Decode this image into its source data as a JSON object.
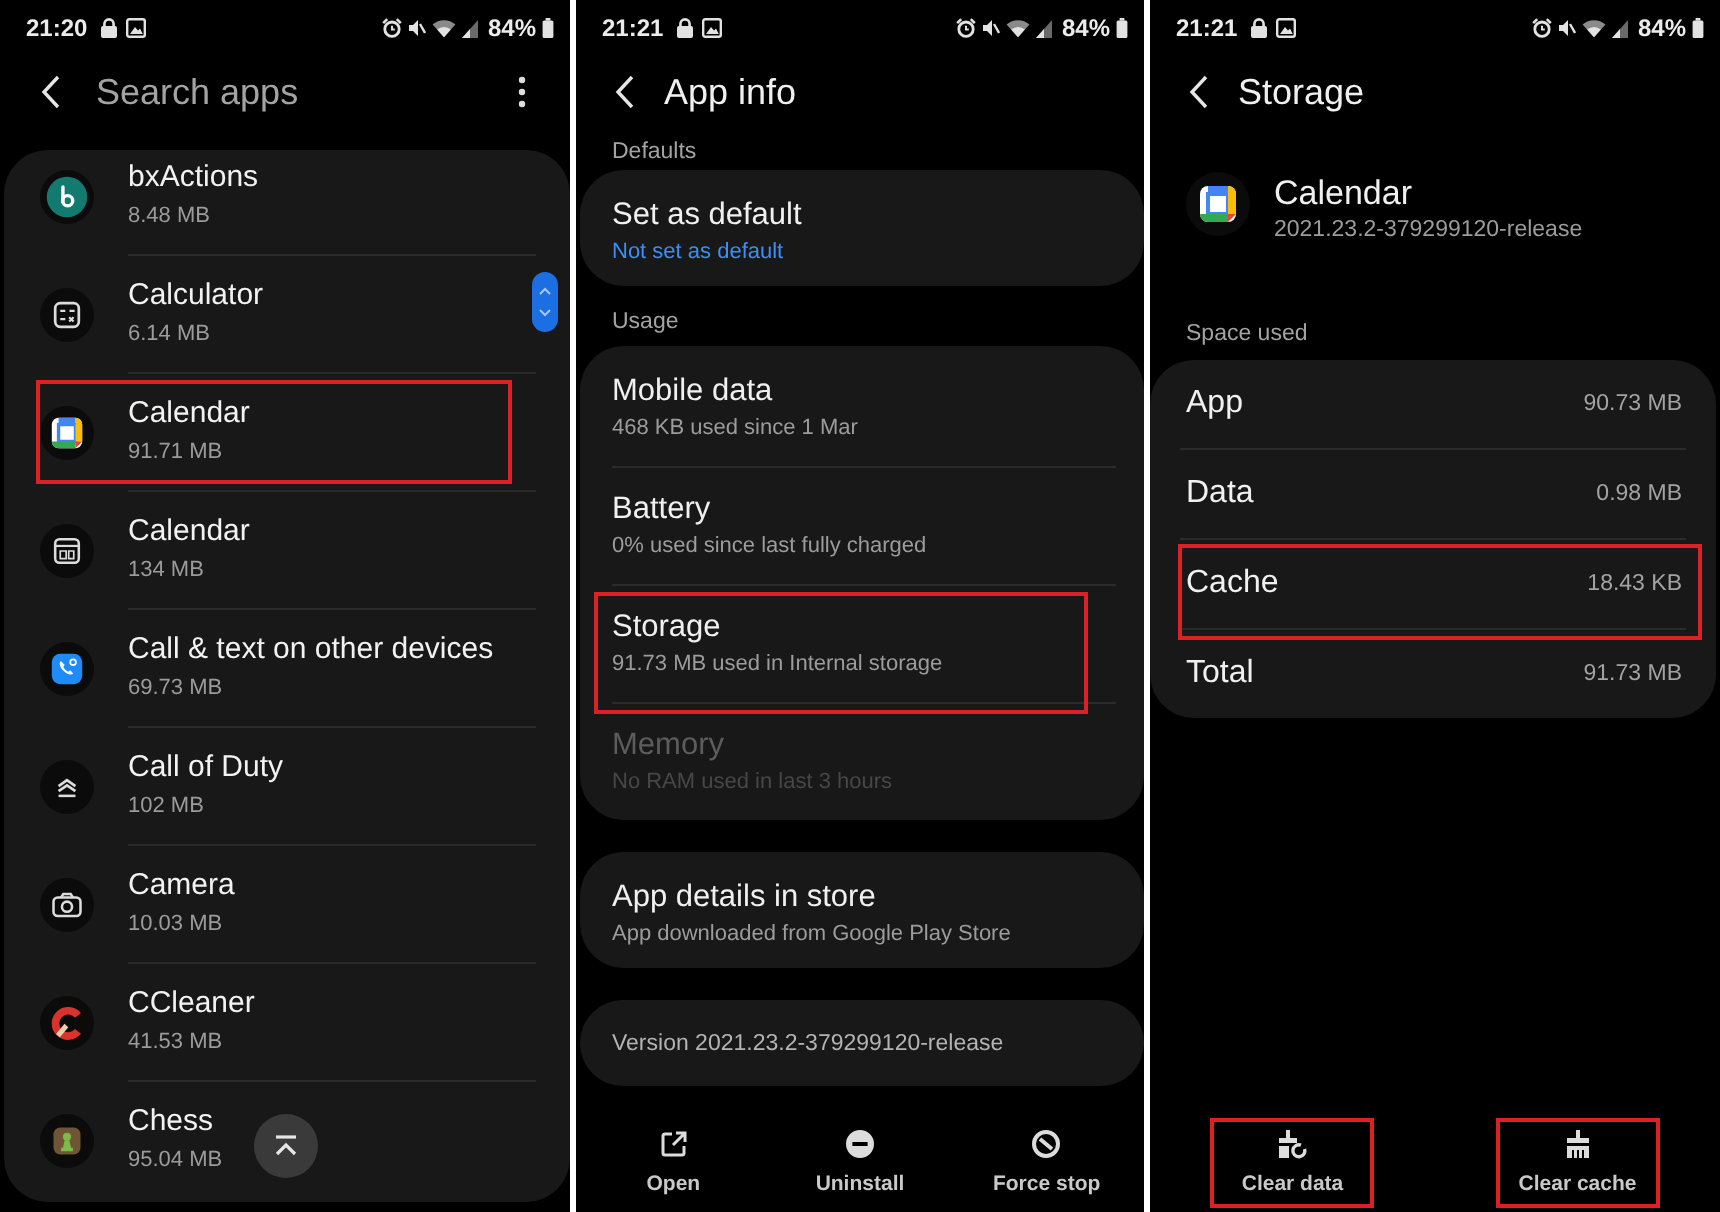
{
  "screens": [
    {
      "kind": "app_list",
      "status_bar": {
        "time": "21:20",
        "battery": "84%"
      },
      "search": {
        "placeholder": "Search apps"
      },
      "apps": [
        {
          "name": "bxActions",
          "size": "8.48 MB",
          "highlighted": false
        },
        {
          "name": "Calculator",
          "size": "6.14 MB",
          "highlighted": false
        },
        {
          "name": "Calendar",
          "size": "91.71 MB",
          "highlighted": true
        },
        {
          "name": "Calendar",
          "size": "134 MB",
          "highlighted": false
        },
        {
          "name": "Call & text on other devices",
          "size": "69.73 MB",
          "highlighted": false
        },
        {
          "name": "Call of Duty",
          "size": "102 MB",
          "highlighted": false
        },
        {
          "name": "Camera",
          "size": "10.03 MB",
          "highlighted": false
        },
        {
          "name": "CCleaner",
          "size": "41.53 MB",
          "highlighted": false
        },
        {
          "name": "Chess",
          "size": "95.04 MB",
          "highlighted": false
        }
      ]
    },
    {
      "kind": "app_info",
      "status_bar": {
        "time": "21:21",
        "battery": "84%"
      },
      "title": "App info",
      "sections": [
        {
          "label": "Defaults",
          "items": [
            {
              "kind": "link",
              "title": "Set as default",
              "subtitle": "Not set as default",
              "disabled": false,
              "highlighted": false
            }
          ]
        },
        {
          "label": "Usage",
          "items": [
            {
              "kind": "plain",
              "title": "Mobile data",
              "subtitle": "468 KB used since 1 Mar",
              "disabled": false,
              "highlighted": false
            },
            {
              "kind": "plain",
              "title": "Battery",
              "subtitle": "0% used since last fully charged",
              "disabled": false,
              "highlighted": false
            },
            {
              "kind": "plain",
              "title": "Storage",
              "subtitle": "91.73 MB used in Internal storage",
              "disabled": false,
              "highlighted": true
            },
            {
              "kind": "plain",
              "title": "Memory",
              "subtitle": "No RAM used in last 3 hours",
              "disabled": true,
              "highlighted": false
            }
          ]
        },
        {
          "items": [
            {
              "kind": "plain",
              "title": "App details in store",
              "subtitle": "App downloaded from Google Play Store",
              "disabled": false,
              "highlighted": false
            }
          ]
        },
        {
          "items": [
            {
              "kind": "note",
              "title": "Version 2021.23.2-379299120-release"
            }
          ]
        }
      ],
      "actions": [
        {
          "label": "Open",
          "highlighted": false
        },
        {
          "label": "Uninstall",
          "highlighted": false
        },
        {
          "label": "Force stop",
          "highlighted": false
        }
      ]
    },
    {
      "kind": "storage",
      "status_bar": {
        "time": "21:21",
        "battery": "84%"
      },
      "title": "Storage",
      "app": {
        "name": "Calendar",
        "version": "2021.23.2-379299120-release"
      },
      "section_label": "Space used",
      "rows": [
        {
          "label": "App",
          "value": "90.73 MB",
          "highlighted": false
        },
        {
          "label": "Data",
          "value": "0.98 MB",
          "highlighted": false
        },
        {
          "label": "Cache",
          "value": "18.43 KB",
          "highlighted": true
        },
        {
          "label": "Total",
          "value": "91.73 MB",
          "highlighted": false
        }
      ],
      "actions": [
        {
          "label": "Clear data",
          "highlighted": true
        },
        {
          "label": "Clear cache",
          "highlighted": true
        }
      ]
    }
  ]
}
